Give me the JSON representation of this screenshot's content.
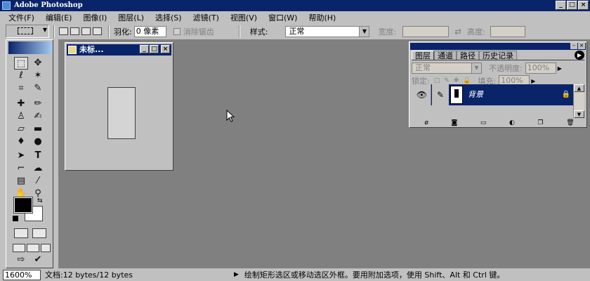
{
  "app": {
    "title": "Adobe Photoshop"
  },
  "menubar": {
    "items": [
      "文件(F)",
      "编辑(E)",
      "图像(I)",
      "图层(L)",
      "选择(S)",
      "滤镜(T)",
      "视图(V)",
      "窗口(W)",
      "帮助(H)"
    ]
  },
  "options": {
    "feather_label": "羽化:",
    "feather_value": "0 像素",
    "antialias_label": "消除锯齿",
    "style_label": "样式:",
    "style_value": "正常",
    "width_label": "宽度:",
    "height_label": "高度:"
  },
  "document": {
    "title": "未标..."
  },
  "layers_palette": {
    "tabs": [
      "图层",
      "通道",
      "路径",
      "历史记录"
    ],
    "blend_mode": "正常",
    "opacity_label": "不透明度:",
    "opacity_value": "100%",
    "lock_label": "锁定:",
    "fill_label": "填充:",
    "fill_value": "100%",
    "layer_name": "背景"
  },
  "status": {
    "zoom": "1600%",
    "doc_info": "文档:12 bytes/12 bytes",
    "hint": "绘制矩形选区或移动选区外框。要用附加选项，使用 Shift、Alt 和 Ctrl 键。"
  }
}
